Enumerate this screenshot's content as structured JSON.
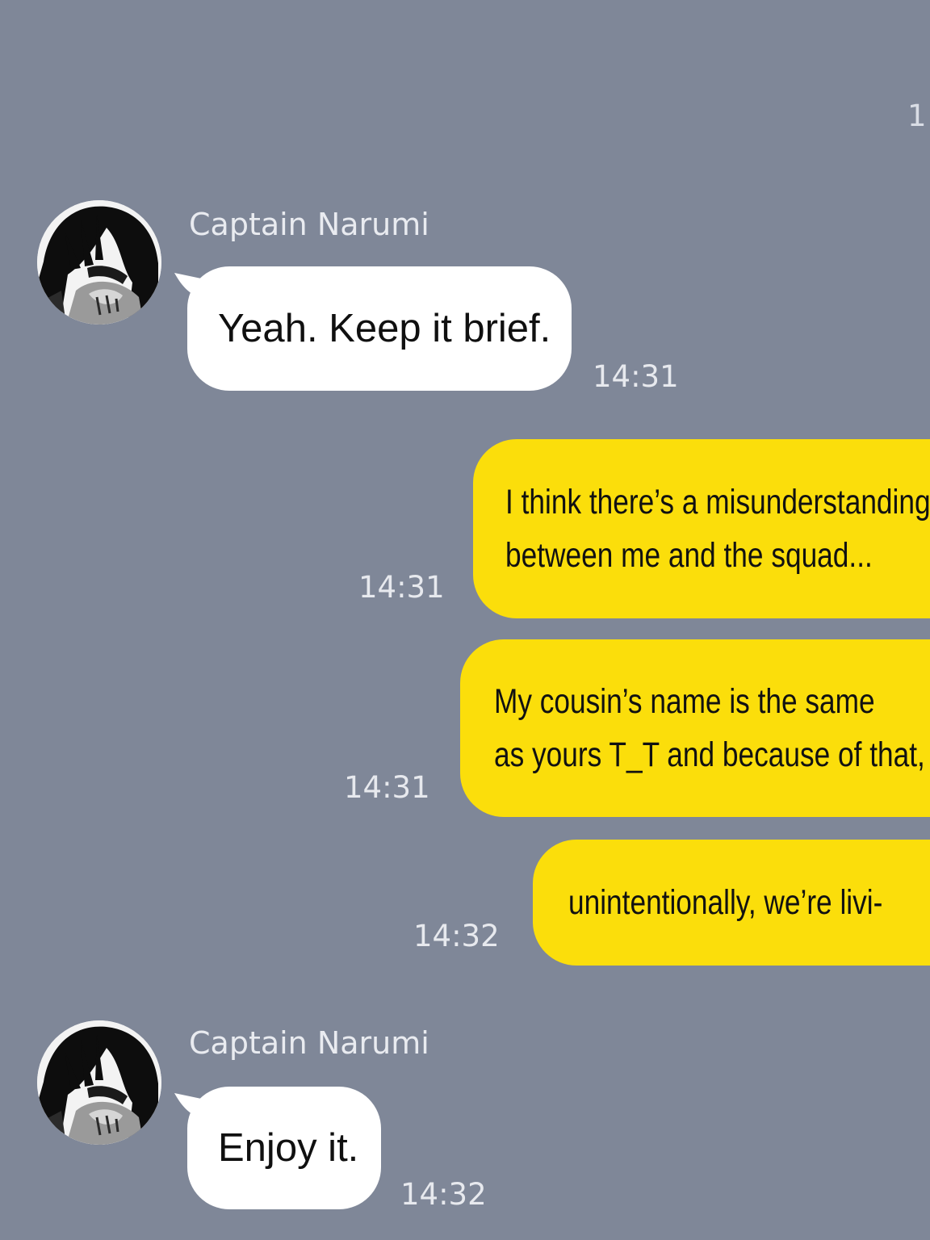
{
  "messages": [
    {
      "id": "m1",
      "direction": "incoming",
      "sender": "Captain Narumi",
      "text": "Yeah. Keep it brief.",
      "time": "14:31"
    },
    {
      "id": "m2",
      "direction": "outgoing",
      "lines": [
        "I think there’s a misunderstanding",
        "between me and the squad..."
      ],
      "time": "14:31"
    },
    {
      "id": "m3",
      "direction": "outgoing",
      "lines": [
        "My cousin’s name is the same",
        "as yours T_T and because of that,"
      ],
      "time": "14:31"
    },
    {
      "id": "m4",
      "direction": "outgoing",
      "lines": [
        "unintentionally, we’re livi-"
      ],
      "time": "14:32"
    },
    {
      "id": "m5",
      "direction": "incoming",
      "sender": "Captain Narumi",
      "text": "Enjoy it.",
      "time": "14:32"
    }
  ],
  "cut_off_time": "1",
  "colors": {
    "background": "#7f8798",
    "incoming_bubble": "#ffffff",
    "outgoing_bubble": "#fbde0b",
    "meta_text": "#e7e9ee"
  },
  "icons": {
    "avatar": "manga-portrait-avatar"
  }
}
